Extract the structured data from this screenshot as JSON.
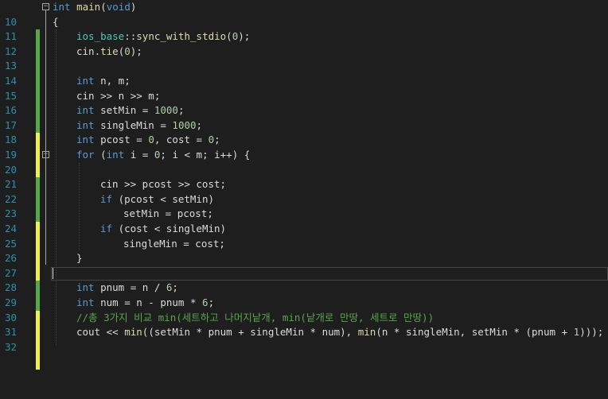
{
  "line_numbers": [
    "10",
    "11",
    "12",
    "13",
    "14",
    "15",
    "16",
    "17",
    "18",
    "19",
    "20",
    "21",
    "22",
    "23",
    "24",
    "25",
    "26",
    "27",
    "28",
    "29",
    "30",
    "31",
    "32"
  ],
  "fold_glyph": "−",
  "colors": {
    "background": "#1e1e1e",
    "keyword": "#569cd6",
    "function": "#dcdcaa",
    "number": "#b5cea8",
    "comment": "#57a64a",
    "line_number": "#2b91af",
    "change_saved": "#57a64a",
    "change_unsaved": "#efef4c"
  },
  "code": {
    "l10_kw": "int",
    "l10_fn": "main",
    "l10_rest": "(",
    "l10_void": "void",
    "l10_end": ")",
    "l11": "{",
    "l12_ns": "ios_base",
    "l12_sep": "::",
    "l12_fn": "sync_with_stdio",
    "l12_open": "(",
    "l12_num": "0",
    "l12_close": ");",
    "l13_obj": "cin",
    "l13_dot": ".",
    "l13_fn": "tie",
    "l13_open": "(",
    "l13_num": "0",
    "l13_close": ");",
    "l15_kw": "int",
    "l15_rest": " n, m;",
    "l16": "cin >> n >> m;",
    "l17_kw": "int",
    "l17_rest": " setMin = ",
    "l17_num": "1000",
    "l17_end": ";",
    "l18_kw": "int",
    "l18_rest": " singleMin = ",
    "l18_num": "1000",
    "l18_end": ";",
    "l19_kw": "int",
    "l19_a": " pcost = ",
    "l19_n1": "0",
    "l19_b": ", cost = ",
    "l19_n2": "0",
    "l19_end": ";",
    "l20_kw1": "for",
    "l20_a": " (",
    "l20_kw2": "int",
    "l20_b": " i = ",
    "l20_n": "0",
    "l20_c": "; i < m; i++) {",
    "l22": "cin >> pcost >> cost;",
    "l23_kw": "if",
    "l23_rest": " (pcost < setMin)",
    "l24": "setMin = pcost;",
    "l25_kw": "if",
    "l25_rest": " (cost < singleMin)",
    "l26": "singleMin = cost;",
    "l27": "}",
    "l29_kw": "int",
    "l29_a": " pnum = n / ",
    "l29_n": "6",
    "l29_end": ";",
    "l30_kw": "int",
    "l30_a": " num = n - pnum * ",
    "l30_n": "6",
    "l30_end": ";",
    "l31": "//총 3가지 비교 min(세트하고 나머지낱개, min(낱개로 만땅, 세트로 만땅))",
    "l32_a": "cout << ",
    "l32_fn1": "min",
    "l32_b": "((setMin * pnum + singleMin * num), ",
    "l32_fn2": "min",
    "l32_c": "(n * singleMin, setMin * (pnum + ",
    "l32_n": "1",
    "l32_d": ")));"
  }
}
